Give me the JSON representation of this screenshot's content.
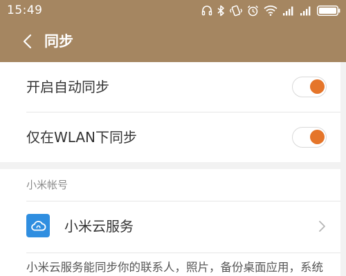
{
  "status_bar": {
    "time": "15:49",
    "icons": [
      "headset-icon",
      "bluetooth-icon",
      "vibrate-icon",
      "alarm-icon",
      "wifi-icon",
      "signal-icon",
      "signal-icon",
      "battery-icon"
    ]
  },
  "action_bar": {
    "back_icon": "back-arrow-icon",
    "title": "同步"
  },
  "sync_settings": {
    "auto_sync": {
      "label": "开启自动同步",
      "enabled": true
    },
    "wlan_only": {
      "label": "仅在WLAN下同步",
      "enabled": true
    }
  },
  "account_section": {
    "header": "小米帐号",
    "service": {
      "label": "小米云服务",
      "icon": "cloud-icon",
      "chevron": "chevron-right-icon"
    },
    "description": "小米云服务能同步你的联系人，照片，备份桌面应用，系统"
  },
  "colors": {
    "header_bg": "#a58661",
    "toggle_on": "#e5752a",
    "service_icon_bg": "#2f8ee0",
    "page_bg": "#f2f2f2"
  }
}
